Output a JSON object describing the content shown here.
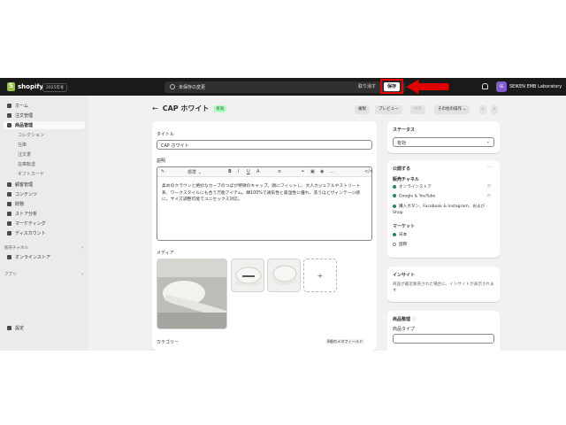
{
  "topbar": {
    "logo": "shopify",
    "edition": "2025年冬",
    "unsaved": "未保存の変更",
    "discard": "取り消す",
    "save": "保存",
    "store_initials": "SE",
    "store_name": "SEIKEN EMB Laboratory"
  },
  "sidebar": {
    "items": [
      {
        "label": "ホーム",
        "type": "main"
      },
      {
        "label": "注文管理",
        "type": "main"
      },
      {
        "label": "商品管理",
        "type": "main",
        "active": true
      },
      {
        "label": "コレクション",
        "type": "sub"
      },
      {
        "label": "在庫",
        "type": "sub"
      },
      {
        "label": "注文書",
        "type": "sub"
      },
      {
        "label": "在庫転送",
        "type": "sub"
      },
      {
        "label": "ギフトカード",
        "type": "sub"
      },
      {
        "label": "顧客管理",
        "type": "main"
      },
      {
        "label": "コンテンツ",
        "type": "main"
      },
      {
        "label": "財務",
        "type": "main"
      },
      {
        "label": "ストア分析",
        "type": "main"
      },
      {
        "label": "マーケティング",
        "type": "main"
      },
      {
        "label": "ディスカウント",
        "type": "main"
      }
    ],
    "sales_channels": "販売チャネル",
    "online_store": "オンラインストア",
    "apps": "アプリ",
    "settings": "設定"
  },
  "page": {
    "title": "CAP ホワイト",
    "status_badge": "有効",
    "duplicate": "複製",
    "preview": "プレビュー",
    "share": "共有",
    "more": "その他の操作"
  },
  "product": {
    "title_label": "タイトル",
    "title_value": "CAP ホワイト",
    "desc_label": "説明",
    "format": "標準",
    "description": "柔めのクラウンと絶妙なカーブのつばが特徴のキャップ。頭にフィットし、大人カジュアルやストリート系、ワークスタイルにも合う万能アイテム。綿100%で通気性と吸湿性に優れ、洗うほどヴィンテージ感に。サイズ調整可能でユニセックス対応。",
    "media_label": "メディア",
    "add": "+",
    "category_label": "カテゴリー",
    "metafields": "8個のメタフィールド"
  },
  "status_card": {
    "title": "ステータス",
    "value": "有効"
  },
  "publishing": {
    "title": "公開する",
    "more": "...",
    "sales_channels": "販売チャネル",
    "channels": [
      "オンラインストア",
      "Google & YouTube",
      "購入ボタン、Facebook & Instagram、および Shop"
    ],
    "markets_title": "マーケット",
    "markets": [
      "日本",
      "国際"
    ]
  },
  "insights": {
    "title": "インサイト",
    "text": "商品が最近販売された場合に、インサイトが表示されます"
  },
  "organization": {
    "title": "商品整理",
    "product_type": "商品タイプ"
  },
  "colors": {
    "accent": "#e00000",
    "topbar": "#1a1a1a",
    "badge_bg": "#affebf",
    "brand": "#95bf47"
  }
}
